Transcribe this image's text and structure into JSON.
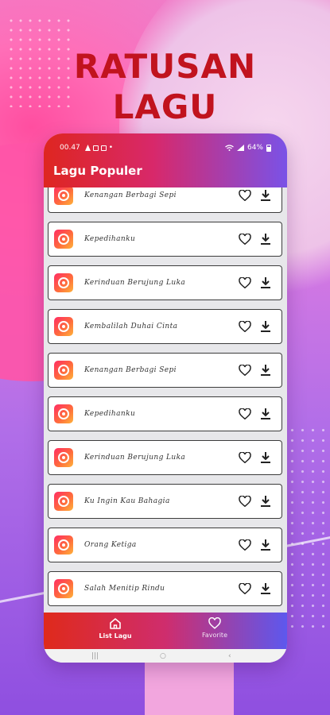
{
  "headline": {
    "line1": "RATUSAN",
    "line2": "LAGU"
  },
  "status_bar": {
    "time": "00.47",
    "dot": "•",
    "battery": "64%"
  },
  "app_bar": {
    "title": "Lagu Populer"
  },
  "songs": [
    {
      "title": "Kenangan Berbagi Sepi"
    },
    {
      "title": "Kepedihanku"
    },
    {
      "title": "Kerinduan Berujung Luka"
    },
    {
      "title": "Kembalilah Duhai Cinta"
    },
    {
      "title": "Kenangan Berbagi Sepi"
    },
    {
      "title": "Kepedihanku"
    },
    {
      "title": "Kerinduan Berujung Luka"
    },
    {
      "title": "Ku Ingin Kau Bahagia"
    },
    {
      "title": "Orang Ketiga"
    },
    {
      "title": "Salah Menitip Rindu"
    }
  ],
  "bottom_nav": {
    "list_label": "List Lagu",
    "favorite_label": "Favorite",
    "active": "List Lagu"
  },
  "colors": {
    "headline": "#c1131e",
    "appbar_start": "#de2620",
    "appbar_end": "#7a52e7"
  },
  "icons": {
    "song": "music-disc-icon",
    "favorite": "heart-outline-icon",
    "download": "download-icon",
    "nav_home": "home-icon",
    "nav_favorite": "heart-icon"
  }
}
